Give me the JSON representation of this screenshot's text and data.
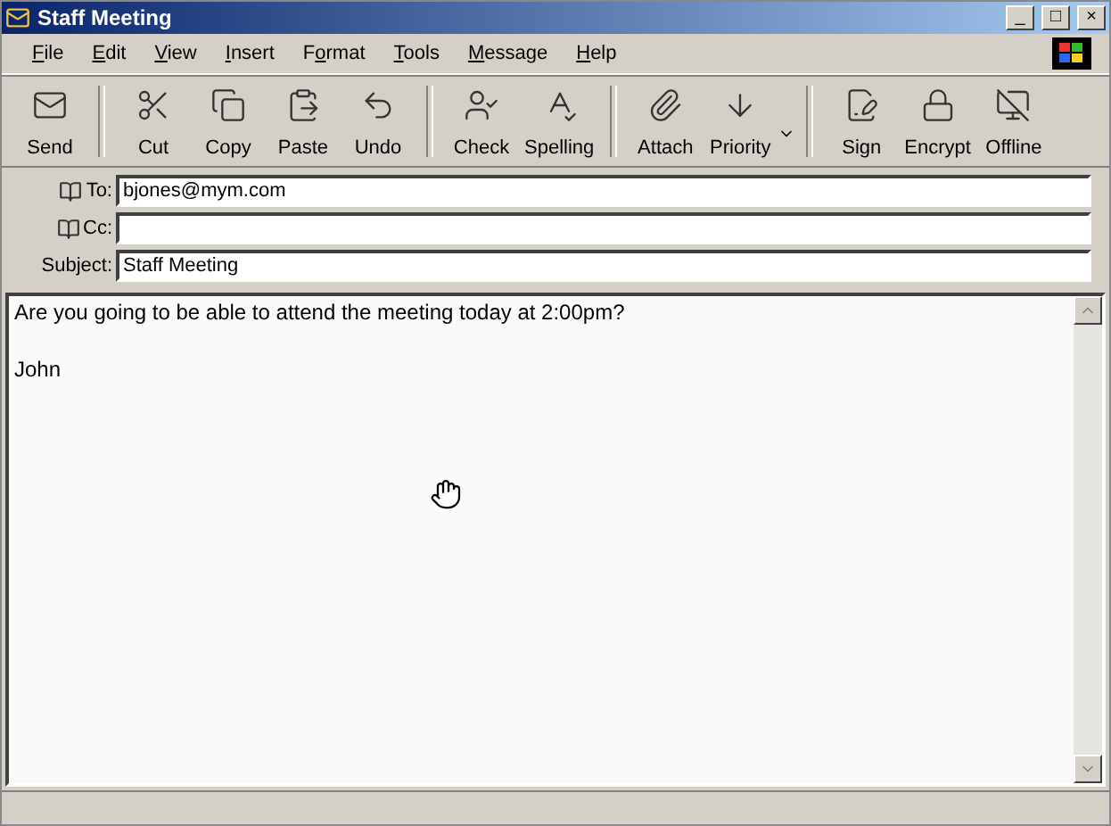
{
  "window": {
    "title": "Staff Meeting",
    "controls": [
      "_",
      "□",
      "×"
    ]
  },
  "menu": [
    {
      "label": "File"
    },
    {
      "label": "Edit"
    },
    {
      "label": "View"
    },
    {
      "label": "Insert"
    },
    {
      "label": "Format"
    },
    {
      "label": "Tools"
    },
    {
      "label": "Message"
    },
    {
      "label": "Help"
    }
  ],
  "toolbar": {
    "groups": [
      [
        {
          "label": "Send"
        }
      ],
      [
        {
          "label": "Cut"
        },
        {
          "label": "Copy"
        },
        {
          "label": "Paste"
        },
        {
          "label": "Undo"
        }
      ],
      [
        {
          "label": "Check"
        },
        {
          "label": "Spelling"
        }
      ],
      [
        {
          "label": "Attach"
        },
        {
          "label": "Priority",
          "has_menu": true
        }
      ],
      [
        {
          "label": "Sign"
        },
        {
          "label": "Encrypt"
        },
        {
          "label": "Offline"
        }
      ]
    ]
  },
  "header": [
    {
      "label": "To:",
      "address_book": true,
      "value": "bjones@mym.com"
    },
    {
      "label": "Cc:",
      "address_book": true
    },
    {
      "label": "Subject:",
      "address_book": false,
      "value": "Staff Meeting"
    }
  ],
  "body": {
    "paragraphs": [
      "Are you going to be able to attend the meeting today at 2:00pm?",
      "John"
    ]
  }
}
